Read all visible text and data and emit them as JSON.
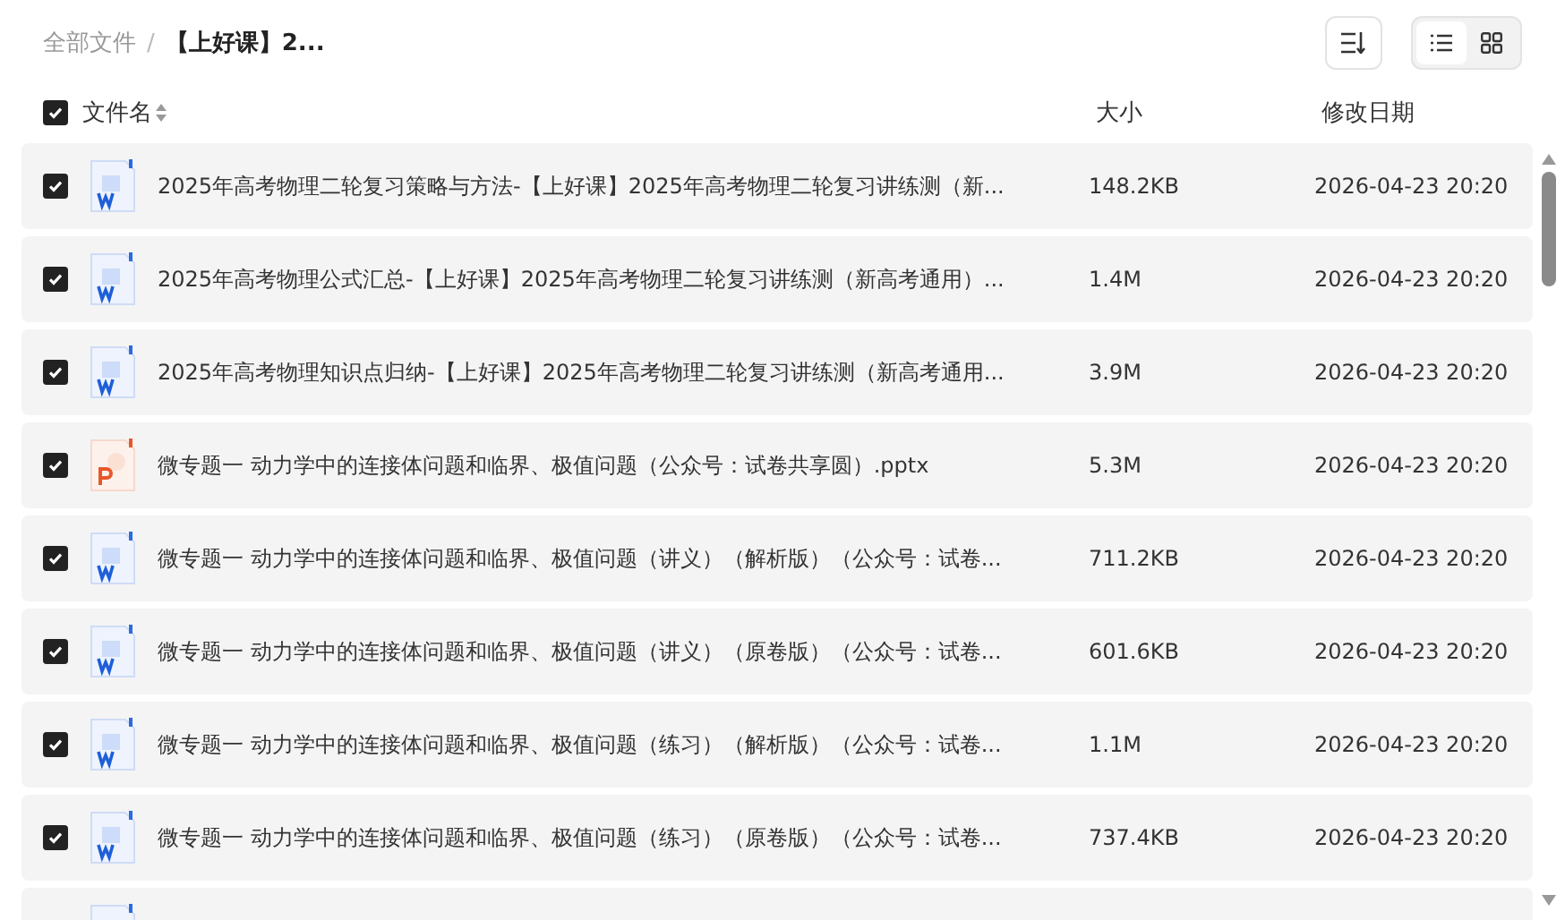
{
  "breadcrumb": [
    {
      "label": "全部文件",
      "current": false
    },
    {
      "label": "【上好课】2...",
      "current": true
    }
  ],
  "breadcrumb_separator": "/",
  "toolbar": {
    "view_modes": [
      {
        "kind": "list",
        "selected": true
      },
      {
        "kind": "grid",
        "selected": false
      }
    ]
  },
  "header": {
    "select_all": {
      "checked": true
    },
    "columns": [
      {
        "label": "文件名",
        "sortable": true
      },
      {
        "label": "大小",
        "sortable": false
      },
      {
        "label": "修改日期",
        "sortable": false
      }
    ]
  },
  "files": [
    {
      "kind": "word",
      "checked": true,
      "name": "2025年高考物理二轮复习策略与方法-【上好课】2025年高考物理二轮复习讲练测（新...",
      "size": "148.2KB",
      "modified": "2026-04-23 20:20"
    },
    {
      "kind": "word",
      "checked": true,
      "name": "2025年高考物理公式汇总-【上好课】2025年高考物理二轮复习讲练测（新高考通用）...",
      "size": "1.4M",
      "modified": "2026-04-23 20:20"
    },
    {
      "kind": "word",
      "checked": true,
      "name": "2025年高考物理知识点归纳-【上好课】2025年高考物理二轮复习讲练测（新高考通用...",
      "size": "3.9M",
      "modified": "2026-04-23 20:20"
    },
    {
      "kind": "ppt",
      "checked": true,
      "name": "微专题一 动力学中的连接体问题和临界、极值问题（公众号：试卷共享圆）.pptx",
      "size": "5.3M",
      "modified": "2026-04-23 20:20"
    },
    {
      "kind": "word",
      "checked": true,
      "name": "微专题一 动力学中的连接体问题和临界、极值问题（讲义）（解析版）（公众号：试卷...",
      "size": "711.2KB",
      "modified": "2026-04-23 20:20"
    },
    {
      "kind": "word",
      "checked": true,
      "name": "微专题一 动力学中的连接体问题和临界、极值问题（讲义）（原卷版）（公众号：试卷...",
      "size": "601.6KB",
      "modified": "2026-04-23 20:20"
    },
    {
      "kind": "word",
      "checked": true,
      "name": "微专题一 动力学中的连接体问题和临界、极值问题（练习）（解析版）（公众号：试卷...",
      "size": "1.1M",
      "modified": "2026-04-23 20:20"
    },
    {
      "kind": "word",
      "checked": true,
      "name": "微专题一 动力学中的连接体问题和临界、极值问题（练习）（原卷版）（公众号：试卷...",
      "size": "737.4KB",
      "modified": "2026-04-23 20:20"
    },
    {
      "kind": "word"
    }
  ]
}
